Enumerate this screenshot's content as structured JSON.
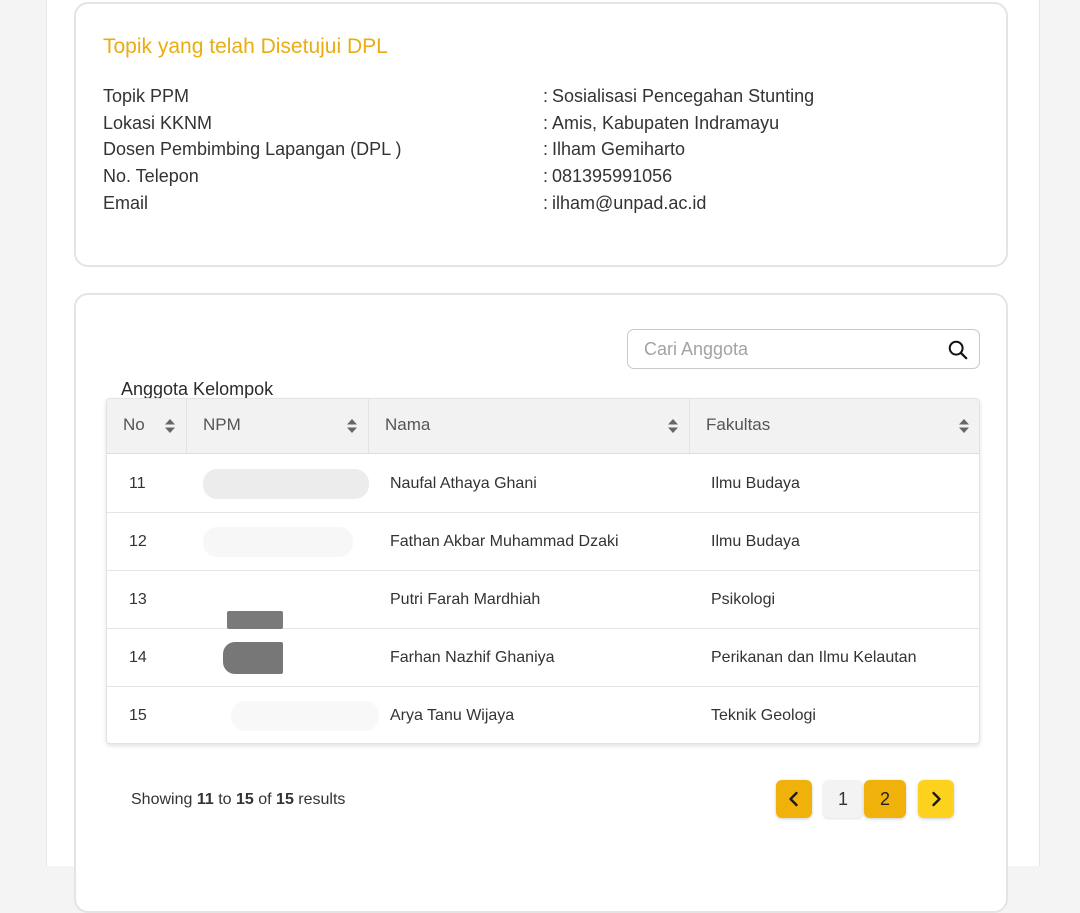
{
  "topic_card": {
    "title": "Topik yang telah Disetujui DPL",
    "rows": [
      {
        "label": "Topik PPM",
        "value": "Sosialisasi Pencegahan Stunting"
      },
      {
        "label": "Lokasi KKNM",
        "value": "Amis, Kabupaten Indramayu"
      },
      {
        "label": "Dosen Pembimbing Lapangan (DPL )",
        "value": "Ilham Gemiharto"
      },
      {
        "label": "No. Telepon",
        "value": "081395991056"
      },
      {
        "label": "Email",
        "value": "ilham@unpad.ac.id"
      }
    ],
    "colon": ":"
  },
  "members_card": {
    "search": {
      "placeholder": "Cari Anggota",
      "value": "",
      "icon": "search-icon"
    },
    "section_label": "Anggota Kelompok",
    "table": {
      "columns": [
        "No",
        "NPM",
        "Nama",
        "Fakultas"
      ],
      "rows": [
        {
          "no": "11",
          "npm": "",
          "nama": "Naufal Athaya Ghani",
          "fakultas": "Ilmu Budaya"
        },
        {
          "no": "12",
          "npm": "",
          "nama": "Fathan Akbar Muhammad Dzaki",
          "fakultas": "Ilmu Budaya"
        },
        {
          "no": "13",
          "npm": "",
          "nama": "Putri Farah Mardhiah",
          "fakultas": "Psikologi"
        },
        {
          "no": "14",
          "npm": "",
          "nama": "Farhan Nazhif Ghaniya",
          "fakultas": "Perikanan dan Ilmu Kelautan"
        },
        {
          "no": "15",
          "npm": "",
          "nama": "Arya Tanu Wijaya",
          "fakultas": "Teknik Geologi"
        }
      ]
    },
    "pagination": {
      "showing": "Showing",
      "from": "11",
      "to_word": "to",
      "to": "15",
      "of_word": "of",
      "total": "15",
      "results": "results",
      "pages": [
        "1",
        "2"
      ],
      "current_page": "2",
      "prev_icon": "chevron-left-icon",
      "next_icon": "chevron-right-icon"
    }
  },
  "colors": {
    "accent": "#e9ad12",
    "pager_active": "#f0b20a",
    "pager_next": "#fcd21e"
  }
}
